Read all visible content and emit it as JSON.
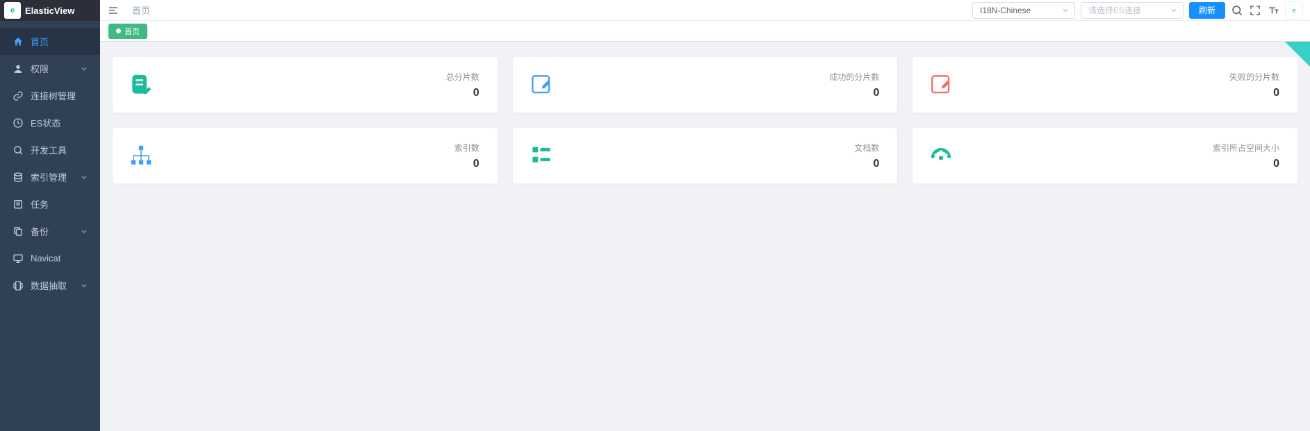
{
  "app_name": "ElasticView",
  "breadcrumb": "首页",
  "header": {
    "lang_select": "I18N-Chinese",
    "es_select_placeholder": "请选择ES连接",
    "refresh_label": "刷新"
  },
  "tabs": [
    {
      "label": "首页",
      "active": true
    }
  ],
  "sidebar": {
    "items": [
      {
        "label": "首页",
        "icon": "home",
        "active": true,
        "expandable": false
      },
      {
        "label": "权限",
        "icon": "user",
        "active": false,
        "expandable": true
      },
      {
        "label": "连接树管理",
        "icon": "link",
        "active": false,
        "expandable": false
      },
      {
        "label": "ES状态",
        "icon": "clock",
        "active": false,
        "expandable": false
      },
      {
        "label": "开发工具",
        "icon": "search",
        "active": false,
        "expandable": false
      },
      {
        "label": "索引管理",
        "icon": "layers",
        "active": false,
        "expandable": true
      },
      {
        "label": "任务",
        "icon": "list",
        "active": false,
        "expandable": false
      },
      {
        "label": "备份",
        "icon": "copy",
        "active": false,
        "expandable": true
      },
      {
        "label": "Navicat",
        "icon": "monitor",
        "active": false,
        "expandable": false
      },
      {
        "label": "数据抽取",
        "icon": "db",
        "active": false,
        "expandable": true
      }
    ]
  },
  "cards": [
    {
      "label": "总分片数",
      "value": "0",
      "icon": "doc-edit",
      "color": "#1abc9c"
    },
    {
      "label": "成功的分片数",
      "value": "0",
      "icon": "note-edit",
      "color": "#409eff"
    },
    {
      "label": "失败的分片数",
      "value": "0",
      "icon": "note-fail",
      "color": "#f56c6c"
    },
    {
      "label": "索引数",
      "value": "0",
      "icon": "tree",
      "color": "#409eff"
    },
    {
      "label": "文档数",
      "value": "0",
      "icon": "list-doc",
      "color": "#1abc9c"
    },
    {
      "label": "索引所占空间大小",
      "value": "0",
      "icon": "gauge",
      "color": "#1abc9c"
    }
  ]
}
